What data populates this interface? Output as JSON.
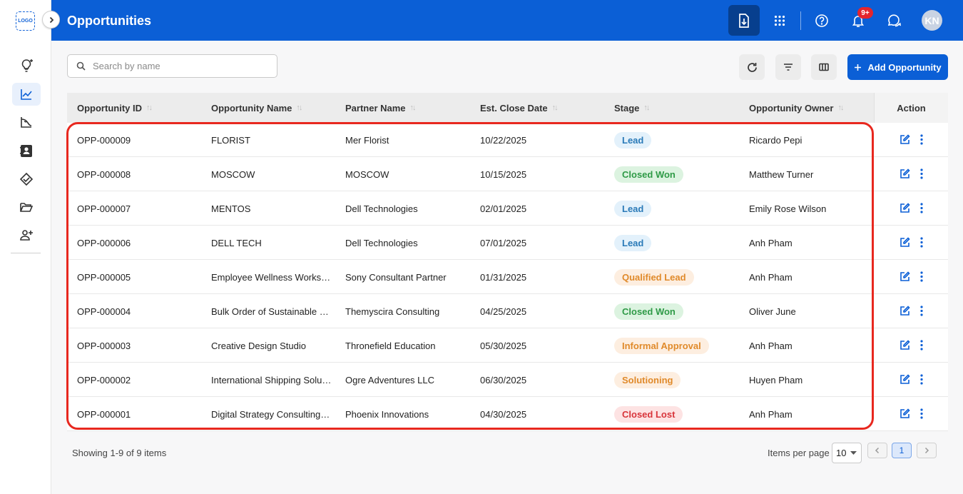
{
  "sidebar": {
    "logo_text": "LOGO",
    "nav": [
      {
        "name": "ideas",
        "icon": "lightbulb-sparkle-icon",
        "active": false
      },
      {
        "name": "opportunities",
        "icon": "chart-line-icon",
        "active": true
      },
      {
        "name": "forecast",
        "icon": "chart-trend-icon",
        "active": false
      },
      {
        "name": "contacts",
        "icon": "contact-book-icon",
        "active": false
      },
      {
        "name": "deals",
        "icon": "handshake-tag-icon",
        "active": false
      },
      {
        "name": "files",
        "icon": "folder-open-icon",
        "active": false
      },
      {
        "name": "add-user",
        "icon": "user-add-icon",
        "active": false
      }
    ]
  },
  "header": {
    "title": "Opportunities",
    "notification_badge": "9+",
    "avatar_initials": "KN"
  },
  "toolbar": {
    "search_placeholder": "Search by name",
    "add_button_label": "Add Opportunity"
  },
  "table": {
    "columns": [
      "Opportunity ID",
      "Opportunity Name",
      "Partner Name",
      "Est. Close Date",
      "Stage",
      "Opportunity Owner"
    ],
    "action_header": "Action",
    "rows": [
      {
        "id": "OPP-000009",
        "name": "FLORIST",
        "partner": "Mer Florist",
        "close": "10/22/2025",
        "stage": "Lead",
        "owner": "Ricardo Pepi"
      },
      {
        "id": "OPP-000008",
        "name": "MOSCOW",
        "partner": "MOSCOW",
        "close": "10/15/2025",
        "stage": "Closed Won",
        "owner": "Matthew Turner"
      },
      {
        "id": "OPP-000007",
        "name": "MENTOS",
        "partner": "Dell Technologies",
        "close": "02/01/2025",
        "stage": "Lead",
        "owner": "Emily Rose Wilson"
      },
      {
        "id": "OPP-000006",
        "name": "DELL TECH",
        "partner": "Dell Technologies",
        "close": "07/01/2025",
        "stage": "Lead",
        "owner": "Anh Pham"
      },
      {
        "id": "OPP-000005",
        "name": "Employee Wellness Works…",
        "partner": "Sony Consultant Partner",
        "close": "01/31/2025",
        "stage": "Qualified Lead",
        "owner": "Anh Pham"
      },
      {
        "id": "OPP-000004",
        "name": "Bulk Order of Sustainable …",
        "partner": "Themyscira Consulting",
        "close": "04/25/2025",
        "stage": "Closed Won",
        "owner": "Oliver June"
      },
      {
        "id": "OPP-000003",
        "name": "Creative Design Studio",
        "partner": "Thronefield Education",
        "close": "05/30/2025",
        "stage": "Informal Approval",
        "owner": "Anh Pham"
      },
      {
        "id": "OPP-000002",
        "name": "International Shipping Solu…",
        "partner": "Ogre Adventures LLC",
        "close": "06/30/2025",
        "stage": "Solutioning",
        "owner": "Huyen Pham"
      },
      {
        "id": "OPP-000001",
        "name": "Digital Strategy Consulting…",
        "partner": "Phoenix Innovations",
        "close": "04/30/2025",
        "stage": "Closed Lost",
        "owner": "Anh Pham"
      }
    ]
  },
  "stage_colors": {
    "Lead": {
      "bg": "#e3f1fb",
      "fg": "#2a7ab8"
    },
    "Closed Won": {
      "bg": "#dcf3e0",
      "fg": "#2e9a46"
    },
    "Qualified Lead": {
      "bg": "#fdeee0",
      "fg": "#e08a2a"
    },
    "Informal Approval": {
      "bg": "#fdeee0",
      "fg": "#e08a2a"
    },
    "Solutioning": {
      "bg": "#fdeee0",
      "fg": "#e08a2a"
    },
    "Closed Lost": {
      "bg": "#fde3e3",
      "fg": "#d8343a"
    }
  },
  "footer": {
    "showing_text": "Showing 1-9 of 9 items",
    "items_per_page_label": "Items per page",
    "items_per_page_value": "10",
    "current_page": "1"
  },
  "colors": {
    "brand": "#0b5fd6",
    "highlight": "#e8281f"
  }
}
